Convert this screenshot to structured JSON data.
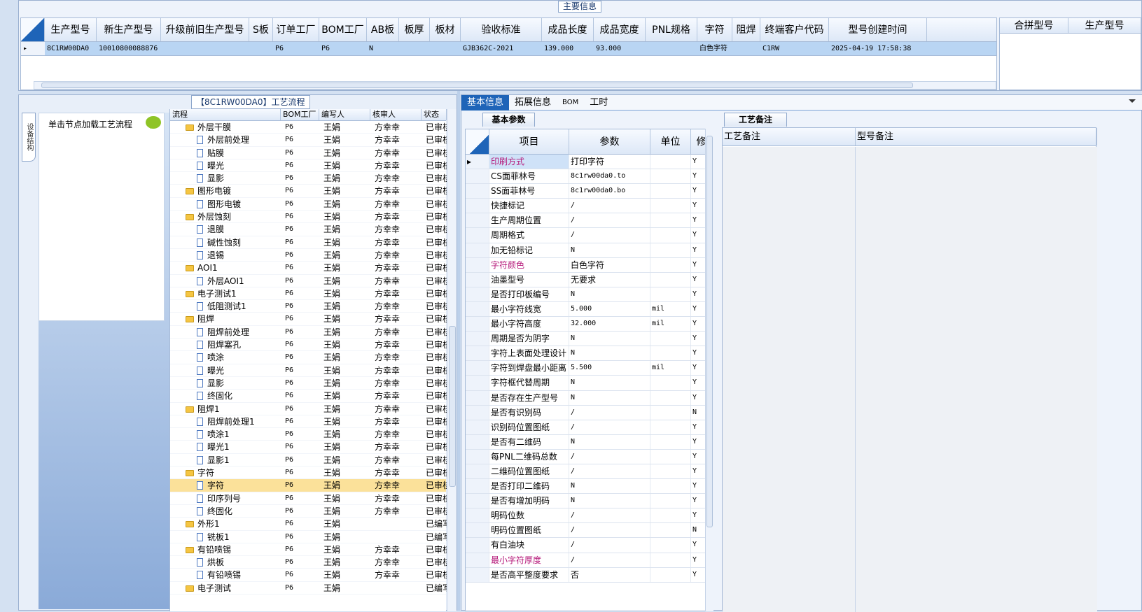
{
  "main": {
    "legend": "主要信息",
    "headers": [
      "",
      "生产型号",
      "新生产型号",
      "升级前旧生产型号",
      "S板",
      "订单工厂",
      "BOM工厂",
      "AB板",
      "板厚",
      "板材",
      "验收标准",
      "成品长度",
      "成品宽度",
      "PNL规格",
      "字符",
      "阻焊",
      "终端客户代码",
      "型号创建时间"
    ],
    "row": [
      "▸",
      "8C1RW00DA0",
      "10010800088876",
      "",
      "",
      "P6",
      "P6",
      "N",
      "",
      "",
      "GJB362C-2021",
      "139.000",
      "93.000",
      "",
      "白色字符",
      "",
      "C1RW",
      "2025-04-19 17:58:38"
    ]
  },
  "side": {
    "headers": [
      "合拼型号",
      "生产型号"
    ]
  },
  "left": {
    "legend": "【8C1RW00DA0】工艺流程",
    "vtab": "设备结构",
    "load_hint": "单击节点加载工艺流程",
    "tree_headers": [
      "流程",
      "BOM工厂",
      "编写人",
      "核审人",
      "状态"
    ],
    "rows": [
      {
        "name": "外层干膜",
        "f": "P6",
        "w": "王娟",
        "r": "方幸幸",
        "s": "已审核",
        "lv": 0
      },
      {
        "name": "外层前处理",
        "f": "P6",
        "w": "王娟",
        "r": "方幸幸",
        "s": "已审核",
        "lv": 1
      },
      {
        "name": "贴膜",
        "f": "P6",
        "w": "王娟",
        "r": "方幸幸",
        "s": "已审核",
        "lv": 1
      },
      {
        "name": "曝光",
        "f": "P6",
        "w": "王娟",
        "r": "方幸幸",
        "s": "已审核",
        "lv": 1
      },
      {
        "name": "显影",
        "f": "P6",
        "w": "王娟",
        "r": "方幸幸",
        "s": "已审核",
        "lv": 1
      },
      {
        "name": "图形电镀",
        "f": "P6",
        "w": "王娟",
        "r": "方幸幸",
        "s": "已审核",
        "lv": 0
      },
      {
        "name": "图形电镀",
        "f": "P6",
        "w": "王娟",
        "r": "方幸幸",
        "s": "已审核",
        "lv": 1
      },
      {
        "name": "外层蚀刻",
        "f": "P6",
        "w": "王娟",
        "r": "方幸幸",
        "s": "已审核",
        "lv": 0
      },
      {
        "name": "退膜",
        "f": "P6",
        "w": "王娟",
        "r": "方幸幸",
        "s": "已审核",
        "lv": 1
      },
      {
        "name": "碱性蚀刻",
        "f": "P6",
        "w": "王娟",
        "r": "方幸幸",
        "s": "已审核",
        "lv": 1
      },
      {
        "name": "退锡",
        "f": "P6",
        "w": "王娟",
        "r": "方幸幸",
        "s": "已审核",
        "lv": 1
      },
      {
        "name": "AOI1",
        "f": "P6",
        "w": "王娟",
        "r": "方幸幸",
        "s": "已审核",
        "lv": 0
      },
      {
        "name": "外层AOI1",
        "f": "P6",
        "w": "王娟",
        "r": "方幸幸",
        "s": "已审核",
        "lv": 1
      },
      {
        "name": "电子测试1",
        "f": "P6",
        "w": "王娟",
        "r": "方幸幸",
        "s": "已审核",
        "lv": 0
      },
      {
        "name": "低阻测试1",
        "f": "P6",
        "w": "王娟",
        "r": "方幸幸",
        "s": "已审核",
        "lv": 1
      },
      {
        "name": "阻焊",
        "f": "P6",
        "w": "王娟",
        "r": "方幸幸",
        "s": "已审核",
        "lv": 0
      },
      {
        "name": "阻焊前处理",
        "f": "P6",
        "w": "王娟",
        "r": "方幸幸",
        "s": "已审核",
        "lv": 1
      },
      {
        "name": "阻焊塞孔",
        "f": "P6",
        "w": "王娟",
        "r": "方幸幸",
        "s": "已审核",
        "lv": 1
      },
      {
        "name": "喷涂",
        "f": "P6",
        "w": "王娟",
        "r": "方幸幸",
        "s": "已审核",
        "lv": 1
      },
      {
        "name": "曝光",
        "f": "P6",
        "w": "王娟",
        "r": "方幸幸",
        "s": "已审核",
        "lv": 1
      },
      {
        "name": "显影",
        "f": "P6",
        "w": "王娟",
        "r": "方幸幸",
        "s": "已审核",
        "lv": 1
      },
      {
        "name": "终固化",
        "f": "P6",
        "w": "王娟",
        "r": "方幸幸",
        "s": "已审核",
        "lv": 1
      },
      {
        "name": "阻焊1",
        "f": "P6",
        "w": "王娟",
        "r": "方幸幸",
        "s": "已审核",
        "lv": 0
      },
      {
        "name": "阻焊前处理1",
        "f": "P6",
        "w": "王娟",
        "r": "方幸幸",
        "s": "已审核",
        "lv": 1
      },
      {
        "name": "喷涂1",
        "f": "P6",
        "w": "王娟",
        "r": "方幸幸",
        "s": "已审核",
        "lv": 1
      },
      {
        "name": "曝光1",
        "f": "P6",
        "w": "王娟",
        "r": "方幸幸",
        "s": "已审核",
        "lv": 1
      },
      {
        "name": "显影1",
        "f": "P6",
        "w": "王娟",
        "r": "方幸幸",
        "s": "已审核",
        "lv": 1
      },
      {
        "name": "字符",
        "f": "P6",
        "w": "王娟",
        "r": "方幸幸",
        "s": "已审核",
        "lv": 0
      },
      {
        "name": "字符",
        "f": "P6",
        "w": "王娟",
        "r": "方幸幸",
        "s": "已审核",
        "lv": 1,
        "sel": true
      },
      {
        "name": "印序列号",
        "f": "P6",
        "w": "王娟",
        "r": "方幸幸",
        "s": "已审核",
        "lv": 1
      },
      {
        "name": "终固化",
        "f": "P6",
        "w": "王娟",
        "r": "方幸幸",
        "s": "已审核",
        "lv": 1
      },
      {
        "name": "外形1",
        "f": "P6",
        "w": "王娟",
        "r": "",
        "s": "已编写",
        "lv": 0
      },
      {
        "name": "铣板1",
        "f": "P6",
        "w": "王娟",
        "r": "",
        "s": "已编写",
        "lv": 1
      },
      {
        "name": "有铅喷锡",
        "f": "P6",
        "w": "王娟",
        "r": "方幸幸",
        "s": "已审核",
        "lv": 0
      },
      {
        "name": "烘板",
        "f": "P6",
        "w": "王娟",
        "r": "方幸幸",
        "s": "已审核",
        "lv": 1
      },
      {
        "name": "有铅喷锡",
        "f": "P6",
        "w": "王娟",
        "r": "方幸幸",
        "s": "已审核",
        "lv": 1
      },
      {
        "name": "电子测试",
        "f": "P6",
        "w": "王娟",
        "r": "",
        "s": "已编写",
        "lv": 0
      }
    ]
  },
  "right": {
    "tabs": [
      "基本信息",
      "拓展信息",
      "BOM",
      "工时"
    ],
    "subtab": "基本参数",
    "param_headers": [
      "",
      "项目",
      "参数",
      "单位",
      "修"
    ],
    "params": [
      {
        "k": "印刷方式",
        "v": "打印字符",
        "u": "",
        "m": "Y",
        "pink": true,
        "cur": true
      },
      {
        "k": "CS面菲林号",
        "v": "8c1rw00da0.to",
        "u": "",
        "m": "Y"
      },
      {
        "k": "SS面菲林号",
        "v": "8c1rw00da0.bo",
        "u": "",
        "m": "Y"
      },
      {
        "k": "快捷标记",
        "v": "/",
        "u": "",
        "m": "Y"
      },
      {
        "k": "生产周期位置",
        "v": "/",
        "u": "",
        "m": "Y"
      },
      {
        "k": "周期格式",
        "v": "/",
        "u": "",
        "m": "Y"
      },
      {
        "k": "加无铅标记",
        "v": "N",
        "u": "",
        "m": "Y"
      },
      {
        "k": "字符颜色",
        "v": "白色字符",
        "u": "",
        "m": "Y",
        "pink": true
      },
      {
        "k": "油墨型号",
        "v": "无要求",
        "u": "",
        "m": "Y"
      },
      {
        "k": "是否打印板编号",
        "v": "N",
        "u": "",
        "m": "Y"
      },
      {
        "k": "最小字符线宽",
        "v": "5.000",
        "u": "mil",
        "m": "Y"
      },
      {
        "k": "最小字符高度",
        "v": "32.000",
        "u": "mil",
        "m": "Y"
      },
      {
        "k": "周期是否为阴字",
        "v": "N",
        "u": "",
        "m": "Y"
      },
      {
        "k": "字符上表面处理设计",
        "v": "N",
        "u": "",
        "m": "Y"
      },
      {
        "k": "字符到焊盘最小距离",
        "v": "5.500",
        "u": "mil",
        "m": "Y"
      },
      {
        "k": "字符框代替周期",
        "v": "N",
        "u": "",
        "m": "Y"
      },
      {
        "k": "是否存在生产型号",
        "v": "N",
        "u": "",
        "m": "Y"
      },
      {
        "k": "是否有识别码",
        "v": "/",
        "u": "",
        "m": "N"
      },
      {
        "k": "识别码位置图纸",
        "v": "/",
        "u": "",
        "m": "Y"
      },
      {
        "k": "是否有二维码",
        "v": "N",
        "u": "",
        "m": "Y"
      },
      {
        "k": "每PNL二维码总数",
        "v": "/",
        "u": "",
        "m": "Y"
      },
      {
        "k": "二维码位置图纸",
        "v": "/",
        "u": "",
        "m": "Y"
      },
      {
        "k": "是否打印二维码",
        "v": "N",
        "u": "",
        "m": "Y"
      },
      {
        "k": "是否有增加明码",
        "v": "N",
        "u": "",
        "m": "Y"
      },
      {
        "k": "明码位数",
        "v": "/",
        "u": "",
        "m": "Y"
      },
      {
        "k": "明码位置图纸",
        "v": "/",
        "u": "",
        "m": "N"
      },
      {
        "k": "有白油块",
        "v": "/",
        "u": "",
        "m": "Y"
      },
      {
        "k": "最小字符厚度",
        "v": "/",
        "u": "",
        "m": "Y",
        "pink": true
      },
      {
        "k": "是否高平整度要求",
        "v": "否",
        "u": "",
        "m": "Y"
      }
    ],
    "notes_tab": "工艺备注",
    "notes_headers": [
      "工艺备注",
      "型号备注"
    ]
  },
  "colors": {
    "accent": "#1e64b8",
    "selected_row": "#fbe19a",
    "pink_text": "#b5187a"
  }
}
